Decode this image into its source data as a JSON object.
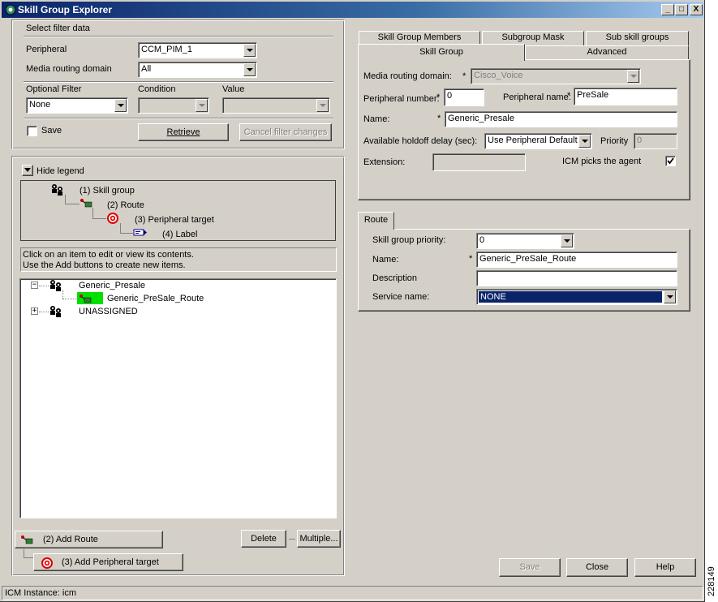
{
  "window": {
    "title": "Skill Group Explorer",
    "min_label": "_",
    "max_label": "□",
    "close_label": "X"
  },
  "filter": {
    "section_label": "Select filter data",
    "peripheral_label": "Peripheral",
    "peripheral_value": "CCM_PIM_1",
    "mrd_label": "Media routing domain",
    "mrd_value": "All",
    "optional_filter_label": "Optional Filter",
    "condition_label": "Condition",
    "value_label": "Value",
    "optional_filter_value": "None",
    "save_label": "Save",
    "save_checked": false,
    "retrieve_label": "Retrieve",
    "cancel_label": "Cancel filter changes"
  },
  "legend": {
    "toggle_label": "Hide legend",
    "items": [
      "(1) Skill group",
      "(2) Route",
      "(3) Peripheral target",
      "(4) Label"
    ]
  },
  "instructions": {
    "line1": "Click on an item to edit or view its contents.",
    "line2": "Use the Add buttons to create new items."
  },
  "tree": {
    "root1": "Generic_Presale",
    "child1": "Generic_PreSale_Route",
    "root2": "UNASSIGNED",
    "expanded_glyph": "−",
    "collapsed_glyph": "+"
  },
  "add_buttons": {
    "add_route": "(2) Add Route",
    "add_peripheral_target": "(3) Add Peripheral target",
    "delete": "Delete",
    "multiple": "Multiple..."
  },
  "tabs": {
    "row1": [
      "Skill Group Members",
      "Subgroup Mask",
      "Sub skill groups"
    ],
    "row2": [
      "Skill Group",
      "Advanced"
    ],
    "active": "Skill Group"
  },
  "skill_group": {
    "required_mark": "*",
    "mrd_label": "Media routing domain:",
    "mrd_value": "Cisco_Voice",
    "peripheral_number_label": "Peripheral number:",
    "peripheral_number_value": "0",
    "peripheral_name_label": "Peripheral name:",
    "peripheral_name_value": "PreSale",
    "name_label": "Name:",
    "name_value": "Generic_Presale",
    "holdoff_label": "Available holdoff delay (sec):",
    "holdoff_value": "Use Peripheral Default",
    "priority_label": "Priority",
    "priority_value": "0",
    "extension_label": "Extension:",
    "extension_value": "",
    "icm_picks_label": "ICM picks the agent",
    "icm_picks_checked": true
  },
  "route": {
    "tab_label": "Route",
    "priority_label": "Skill group priority:",
    "priority_value": "0",
    "name_label": "Name:",
    "name_value": "Generic_PreSale_Route",
    "description_label": "Description",
    "description_value": "",
    "service_label": "Service name:",
    "service_value": "NONE"
  },
  "footer": {
    "save": "Save",
    "close": "Close",
    "help": "Help"
  },
  "status": {
    "text": "ICM Instance: icm"
  },
  "side_id": "228149",
  "colors": {
    "title_start": "#0a246a",
    "title_end": "#a6caf0",
    "selection": "#0a246a",
    "tree_highlight": "#00e000",
    "face": "#d4d0c8"
  }
}
